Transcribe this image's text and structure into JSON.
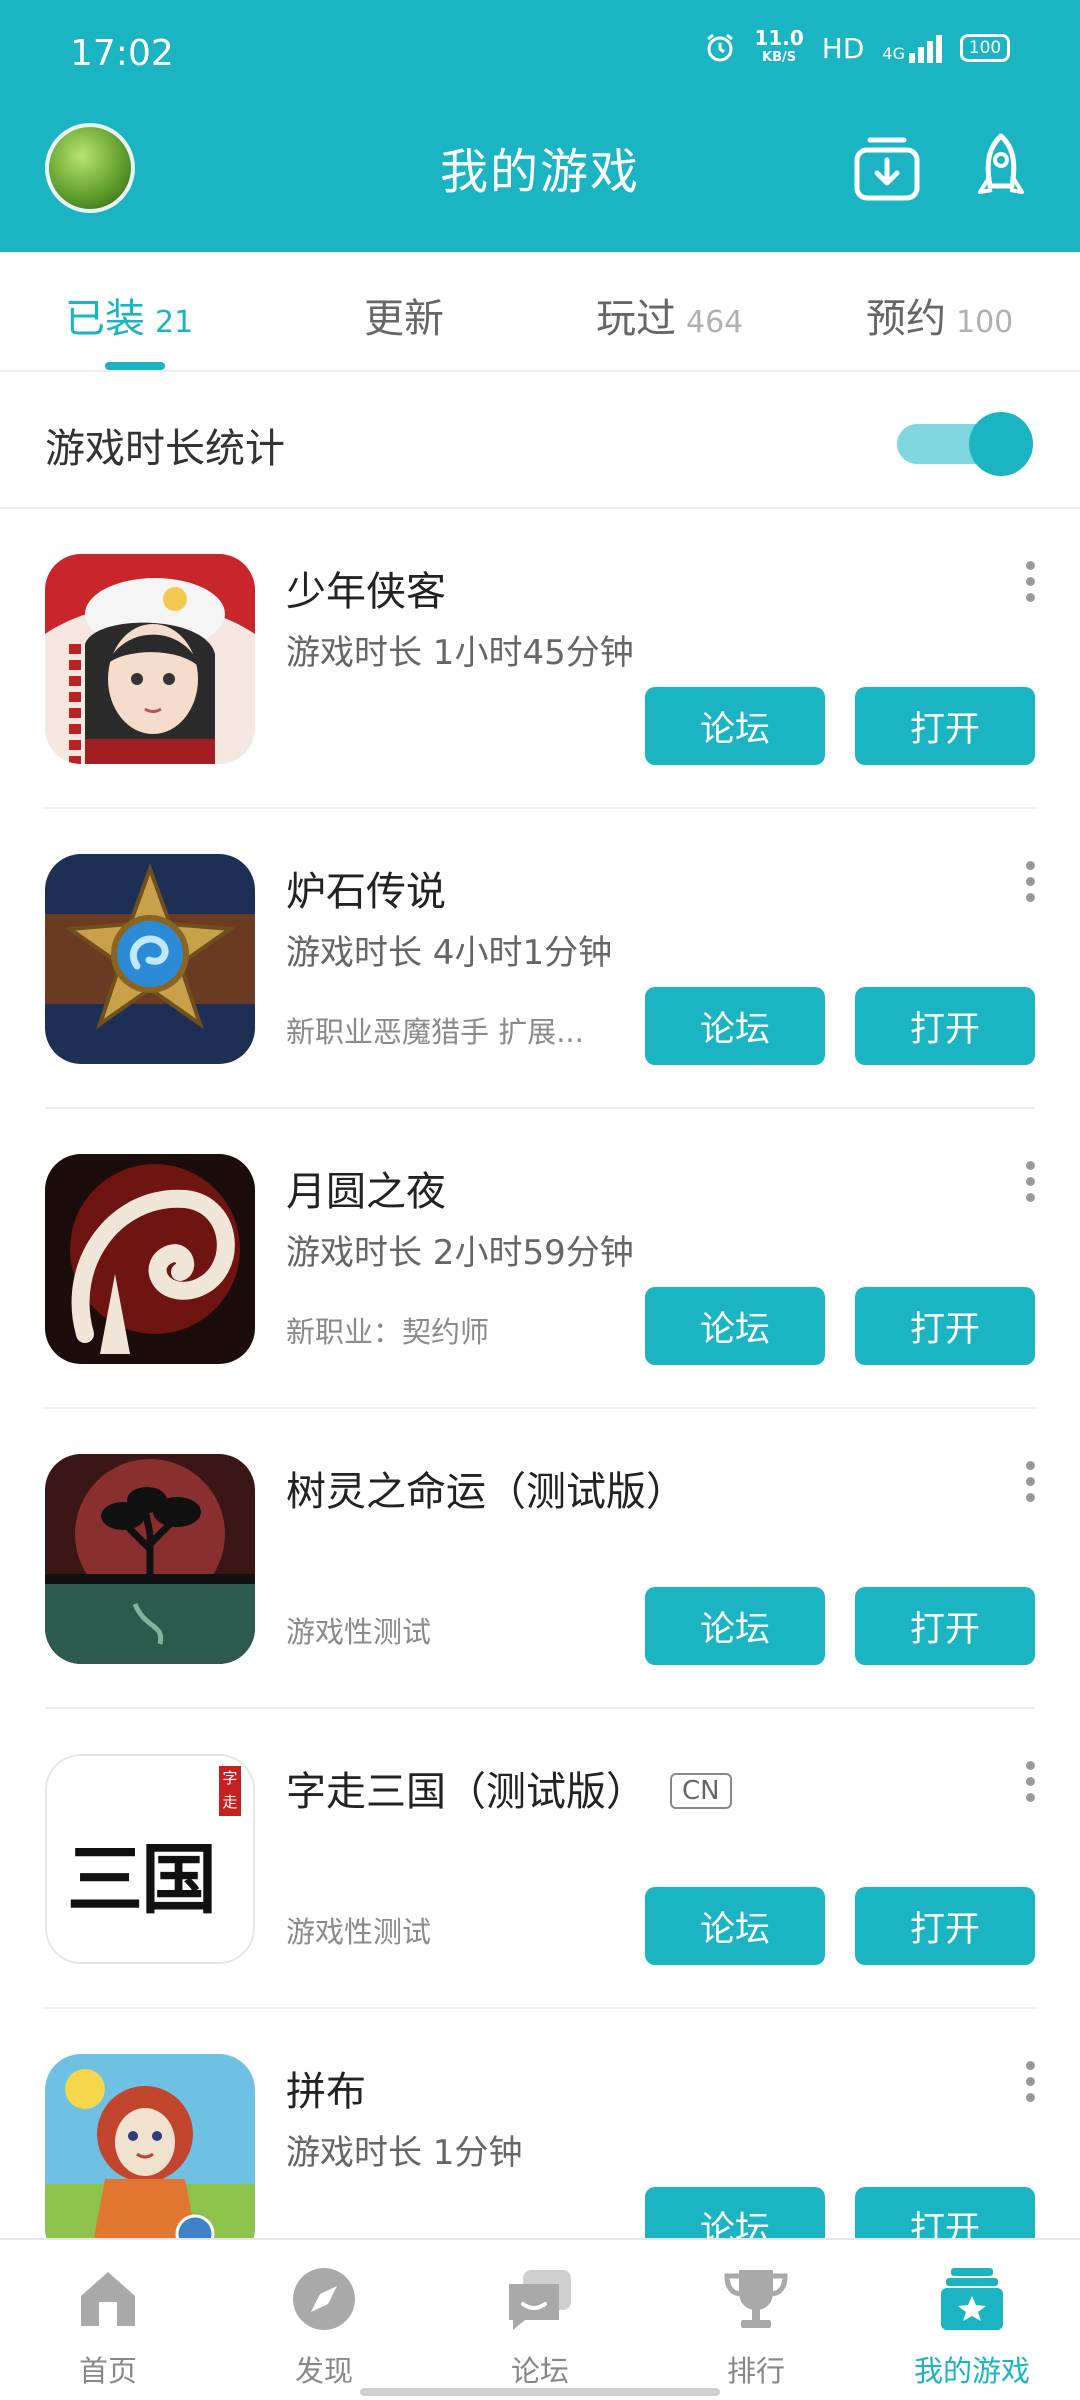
{
  "status_bar": {
    "time": "17:02",
    "net_speed_value": "11.0",
    "net_speed_unit": "KB/S",
    "hd": "HD",
    "network": "4G",
    "battery": "100"
  },
  "header": {
    "title": "我的游戏",
    "accent_color": "#1ab4c3"
  },
  "tabs": [
    {
      "label": "已装",
      "count": "21",
      "active": true
    },
    {
      "label": "更新",
      "count": "",
      "active": false
    },
    {
      "label": "玩过",
      "count": "464",
      "active": false
    },
    {
      "label": "预约",
      "count": "100",
      "active": false
    }
  ],
  "stats": {
    "label": "游戏时长统计",
    "enabled": true
  },
  "games": [
    {
      "name": "少年侠客",
      "tag": "",
      "playtime": "游戏时长 1小时45分钟",
      "desc": "",
      "forum": "论坛",
      "open": "打开",
      "icon": "shaonian-xiake-icon"
    },
    {
      "name": "炉石传说",
      "tag": "",
      "playtime": "游戏时长 4小时1分钟",
      "desc": "新职业恶魔猎手 扩展...",
      "forum": "论坛",
      "open": "打开",
      "icon": "hearthstone-icon"
    },
    {
      "name": "月圆之夜",
      "tag": "",
      "playtime": "游戏时长 2小时59分钟",
      "desc": "新职业：契约师",
      "forum": "论坛",
      "open": "打开",
      "icon": "full-moon-night-icon"
    },
    {
      "name": "树灵之命运（测试版）",
      "tag": "",
      "playtime": "",
      "desc": "游戏性测试",
      "forum": "论坛",
      "open": "打开",
      "icon": "tree-spirit-icon"
    },
    {
      "name": "字走三国（测试版）",
      "tag": "CN",
      "playtime": "",
      "desc": "游戏性测试",
      "forum": "论坛",
      "open": "打开",
      "icon": "sanguo-icon",
      "icon_text": "三国",
      "icon_seal": "字走"
    },
    {
      "name": "拼布",
      "tag": "",
      "playtime": "游戏时长 1分钟",
      "desc": "",
      "forum": "论坛",
      "open": "打开",
      "icon": "patchwork-icon"
    }
  ],
  "bottom_nav": [
    {
      "label": "首页",
      "icon": "home-icon",
      "active": false
    },
    {
      "label": "发现",
      "icon": "compass-icon",
      "active": false
    },
    {
      "label": "论坛",
      "icon": "forum-icon",
      "active": false
    },
    {
      "label": "排行",
      "icon": "trophy-icon",
      "active": false
    },
    {
      "label": "我的游戏",
      "icon": "my-games-icon",
      "active": true
    }
  ]
}
